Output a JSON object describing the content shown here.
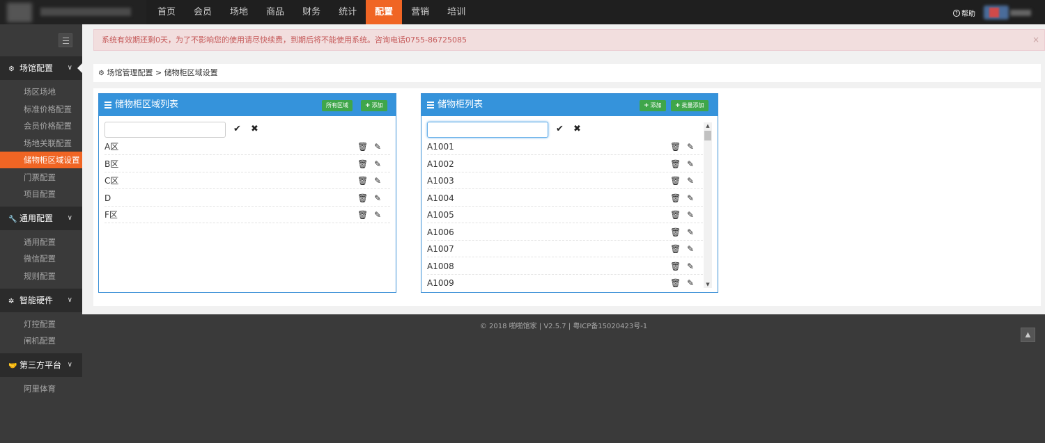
{
  "nav": {
    "items": [
      "首页",
      "会员",
      "场地",
      "商品",
      "财务",
      "统计",
      "配置",
      "营销",
      "培训"
    ],
    "active": "配置",
    "help_label": "帮助"
  },
  "sidebar": {
    "sections": [
      {
        "label": "场馆配置",
        "icon": "gears-icon",
        "items": [
          "场区场地",
          "标准价格配置",
          "会员价格配置",
          "场地关联配置",
          "储物柜区域设置",
          "门票配置",
          "项目配置"
        ]
      },
      {
        "label": "通用配置",
        "icon": "wrench-icon",
        "items": [
          "通用配置",
          "微信配置",
          "规则配置"
        ]
      },
      {
        "label": "智能硬件",
        "icon": "gear-icon",
        "items": [
          "灯控配置",
          "闸机配置"
        ]
      },
      {
        "label": "第三方平台",
        "icon": "handshake-icon",
        "items": [
          "阿里体育"
        ]
      }
    ],
    "active_item": "储物柜区域设置"
  },
  "alert": {
    "text": "系统有效期还剩0天，为了不影响您的使用请尽快续费，到期后将不能使用系统。咨询电话0755-86725085",
    "close": "×"
  },
  "breadcrumb": {
    "parent": "场馆管理配置",
    "separator": ">",
    "current": "储物柜区域设置"
  },
  "area_panel": {
    "title": "储物柜区域列表",
    "btn_all": "所有区域",
    "btn_add": "添加",
    "input_value": "",
    "rows": [
      "A区",
      "B区",
      "C区",
      "D",
      "F区"
    ]
  },
  "locker_panel": {
    "title": "储物柜列表",
    "btn_add": "添加",
    "btn_batch": "批量添加",
    "input_value": "",
    "rows": [
      "A1001",
      "A1002",
      "A1003",
      "A1004",
      "A1005",
      "A1006",
      "A1007",
      "A1008",
      "A1009"
    ]
  },
  "footer": {
    "text": "© 2018 啪啪馆家 | V2.5.7 | 粤ICP备15020423号-1"
  },
  "colors": {
    "accent": "#f06524",
    "panel_blue": "#3593db",
    "button_green": "#3fa64a",
    "alert_bg": "#f2dede"
  }
}
